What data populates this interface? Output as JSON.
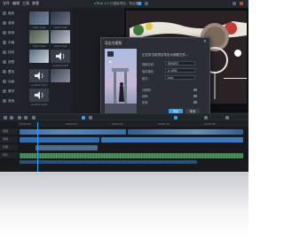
{
  "titlebar": {
    "menus": [
      "文件",
      "编辑",
      "工具",
      "查看"
    ],
    "title": "xTitle 1.0 已渲染项目 - 导出视频"
  },
  "sidebar": {
    "items": [
      "媒体",
      "音频",
      "转场",
      "字幕",
      "特效",
      "滤镜",
      "叠加",
      "动画",
      "素材",
      "其他"
    ]
  },
  "media": {
    "items": [
      "clip1.mp4",
      "clip2.mp4",
      "clip3.mp4",
      "clip4.mp4",
      "audio1.mp3",
      "audio2.mp3",
      "audio3.mp3"
    ]
  },
  "dialog": {
    "title": "导出为视频",
    "message": "正在将当前项目导出为视频文件...",
    "fields": [
      {
        "label": "视频名称:",
        "value": "我的项目"
      },
      {
        "label": "保存路径:",
        "value": "D:\\视频"
      },
      {
        "label": "格式:",
        "value": "MP4"
      }
    ],
    "options": [
      "分辨率:",
      "帧率:",
      "质量:"
    ],
    "export_label": "导出",
    "cancel_label": "取消"
  },
  "timeline": {
    "tracks": [
      "视频",
      "音频",
      "字幕",
      "音乐"
    ],
    "ruler": [
      "00:00:00",
      "00:00:10",
      "00:00:20",
      "00:00:30",
      "00:00:40"
    ]
  },
  "colors": {
    "accent": "#2aa3ff",
    "clip_blue": "#2f6fb0",
    "clip_green": "#3f7d4a"
  }
}
